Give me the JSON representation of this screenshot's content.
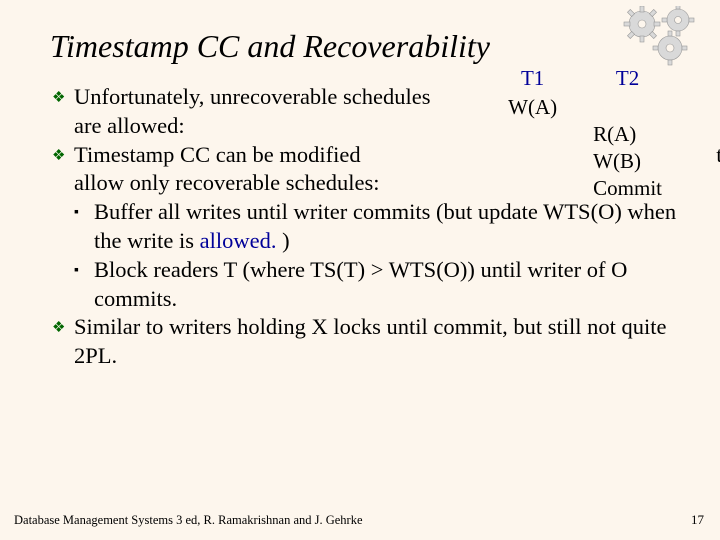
{
  "title": "Timestamp CC and Recoverability",
  "bullets": {
    "b1": "Unfortunately, unrecoverable schedules are allowed:",
    "b2_pre": "Timestamp CC can be modified ",
    "b2_post": "allow only recoverable schedules:",
    "b2_overlap": "to",
    "s1_a": "Buffer all writes until writer commits (but update WTS(O) when the write is ",
    "s1_b": "allowed.",
    "s1_c": " )",
    "s2": "Block readers T (where TS(T) > WTS(O)) until writer of O commits.",
    "b3": "Similar to writers holding X locks until commit, but still not quite 2PL."
  },
  "table": {
    "h1": "T1",
    "h2": "T2",
    "r1c1": "W(A)",
    "r2c2": "R(A)",
    "r3c2": "W(B)",
    "r4c2": "Commit"
  },
  "footer": "Database Management Systems 3 ed,  R. Ramakrishnan and J. Gehrke",
  "page": "17"
}
